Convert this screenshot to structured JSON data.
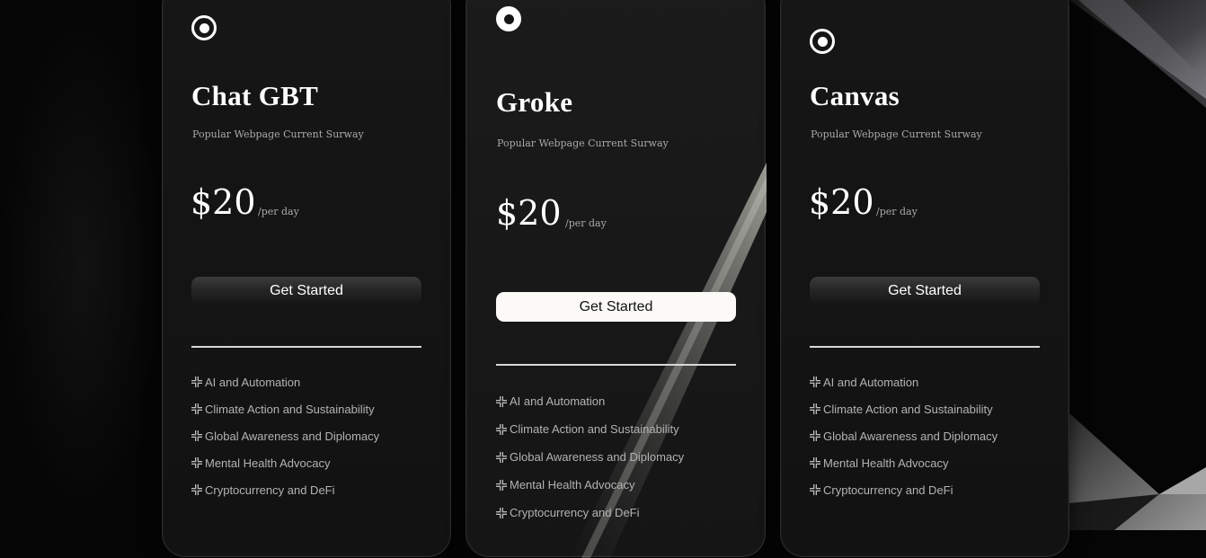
{
  "colors": {
    "background": "#050505",
    "card": "#151515",
    "text_primary": "#ffffff",
    "text_secondary": "#a9a9a9",
    "button_light": "#fbfaf7"
  },
  "plans": [
    {
      "icon": "target-icon",
      "name": "Chat GBT",
      "subtitle": "Popular Webpage Current Surway",
      "price": "$20",
      "period": "/per day",
      "cta": "Get Started",
      "features": [
        "AI and Automation",
        "Climate Action and Sustainability",
        "Global Awareness and Diplomacy",
        "Mental Health Advocacy",
        "Cryptocurrency and DeFi"
      ]
    },
    {
      "icon": "target-icon",
      "name": "Groke",
      "subtitle": "Popular Webpage Current Surway",
      "price": "$20",
      "period": "/per day",
      "cta": "Get Started",
      "highlighted": true,
      "features": [
        "AI and Automation",
        "Climate Action and Sustainability",
        "Global Awareness and Diplomacy",
        "Mental Health Advocacy",
        "Cryptocurrency and DeFi"
      ]
    },
    {
      "icon": "target-icon",
      "name": "Canvas",
      "subtitle": "Popular Webpage Current Surway",
      "price": "$20",
      "period": "/per day",
      "cta": "Get Started",
      "features": [
        "AI and Automation",
        "Climate Action and Sustainability",
        "Global Awareness and Diplomacy",
        "Mental Health Advocacy",
        "Cryptocurrency and DeFi"
      ]
    }
  ],
  "feature_icon": "grid-cross-icon"
}
